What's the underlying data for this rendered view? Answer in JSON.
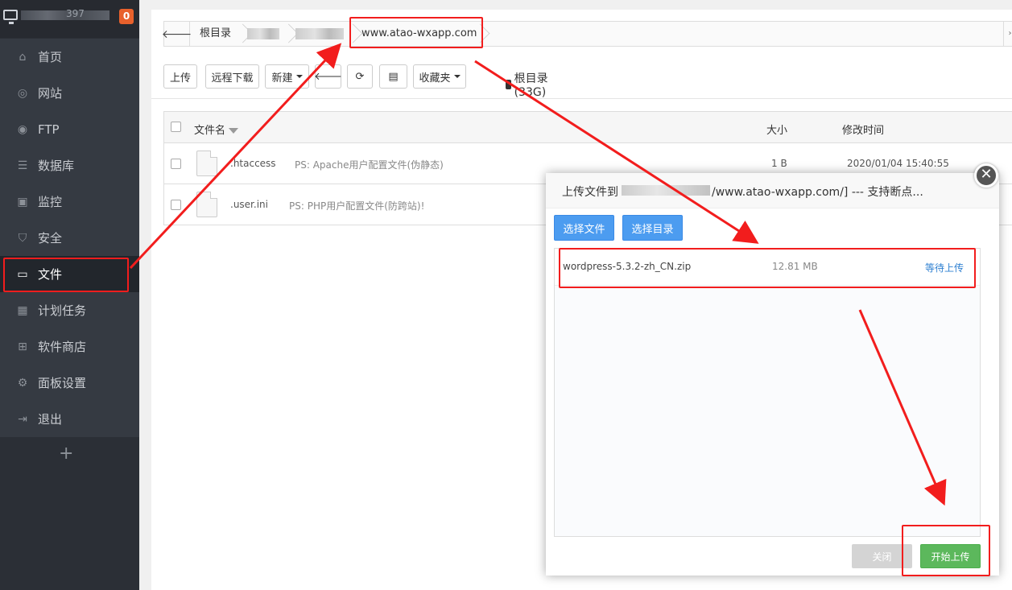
{
  "sidebar": {
    "ip_fragment": "397",
    "badge": "0",
    "menu": [
      {
        "label": "首页",
        "icon": "home-icon"
      },
      {
        "label": "网站",
        "icon": "globe-icon"
      },
      {
        "label": "FTP",
        "icon": "ftp-icon"
      },
      {
        "label": "数据库",
        "icon": "database-icon"
      },
      {
        "label": "监控",
        "icon": "monitor-icon"
      },
      {
        "label": "安全",
        "icon": "shield-icon"
      },
      {
        "label": "文件",
        "icon": "folder-icon",
        "active": true
      },
      {
        "label": "计划任务",
        "icon": "calendar-icon"
      },
      {
        "label": "软件商店",
        "icon": "grid-icon"
      },
      {
        "label": "面板设置",
        "icon": "gear-icon"
      },
      {
        "label": "退出",
        "icon": "logout-icon"
      }
    ],
    "add": "+"
  },
  "breadcrumb": {
    "root": "根目录",
    "current": "www.atao-wxapp.com"
  },
  "toolbar": {
    "upload": "上传",
    "remote_download": "远程下载",
    "new": "新建",
    "favorites": "收藏夹",
    "disk": "根目录(33G)"
  },
  "table": {
    "headers": {
      "name": "文件名",
      "size": "大小",
      "mtime": "修改时间"
    },
    "rows": [
      {
        "name": ".htaccess",
        "note": "PS: Apache用户配置文件(伪静态)",
        "size": "1 B",
        "mtime": "2020/01/04 15:40:55"
      },
      {
        "name": ".user.ini",
        "note": "PS: PHP用户配置文件(防跨站)!",
        "size": "",
        "mtime": ""
      }
    ]
  },
  "dialog": {
    "title_prefix": "上传文件到",
    "title_suffix": "/www.atao-wxapp.com/] --- 支持断点...",
    "choose_file": "选择文件",
    "choose_dir": "选择目录",
    "file": {
      "name": "wordpress-5.3.2-zh_CN.zip",
      "size": "12.81 MB",
      "status": "等待上传"
    },
    "close": "关闭",
    "start": "开始上传"
  },
  "colors": {
    "sidebar_bg": "#353a42",
    "primary_blue": "#4c9cf0",
    "success_green": "#5cb85c",
    "annotation_red": "#f21d1d"
  }
}
